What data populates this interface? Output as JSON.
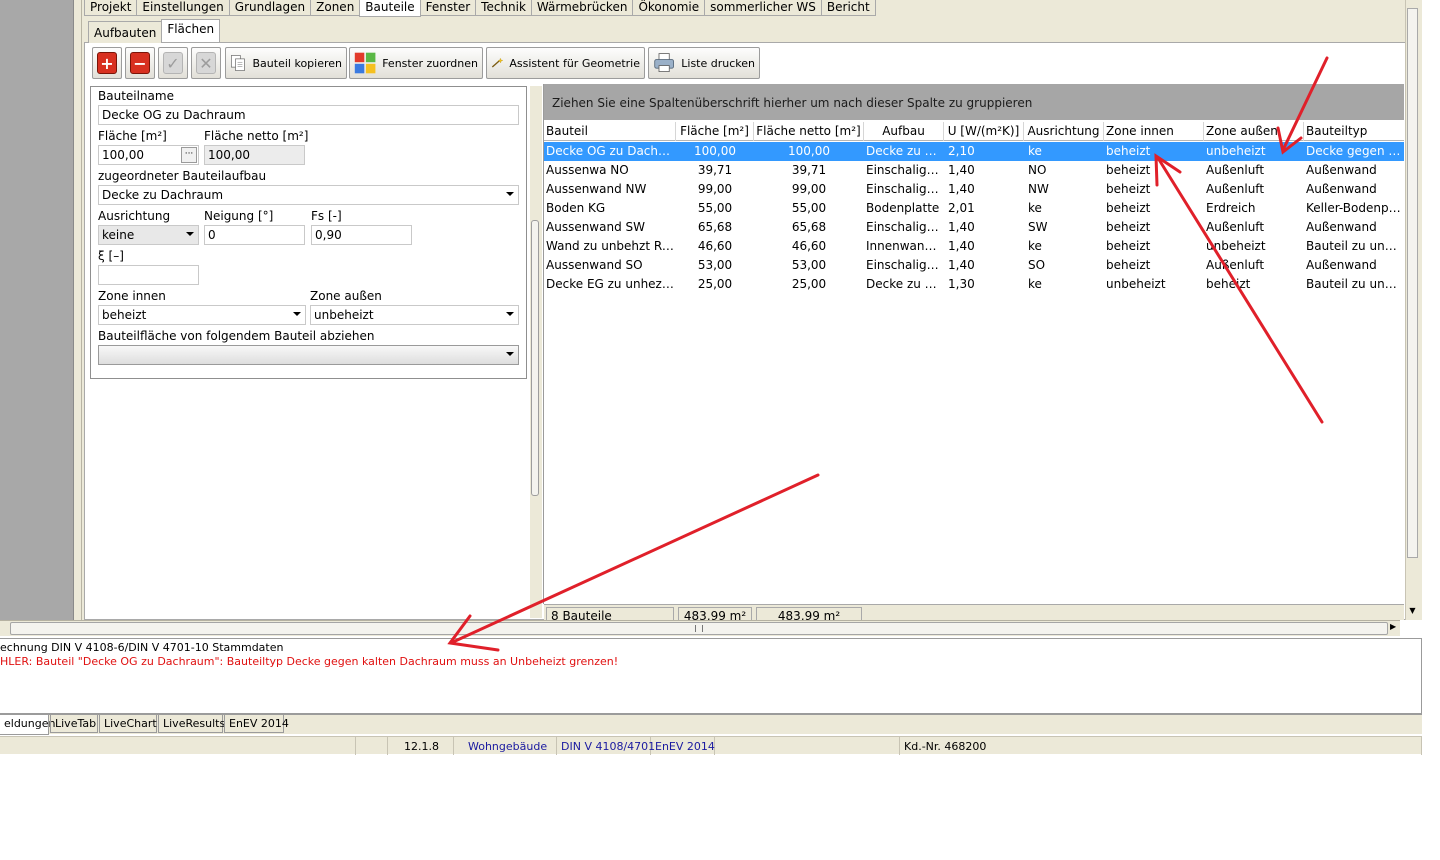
{
  "top_tabs": [
    "Projekt",
    "Einstellungen",
    "Grundlagen",
    "Zonen",
    "Bauteile",
    "Fenster",
    "Technik",
    "Wärmebrücken",
    "Ökonomie",
    "sommerlicher WS",
    "Bericht"
  ],
  "sub_tabs": [
    "Aufbauten",
    "Flächen"
  ],
  "toolbar": {
    "copy_label": "Bauteil kopieren",
    "window_label": "Fenster zuordnen",
    "geometry_label": "Assistent für Geometrie",
    "print_label": "Liste drucken"
  },
  "form": {
    "name_label": "Bauteilname",
    "name_value": "Decke OG zu Dachraum",
    "area_label": "Fläche [m²]",
    "area_value": "100,00",
    "net_area_label": "Fläche netto [m²]",
    "net_area_value": "100,00",
    "construction_label": "zugeordneter Bauteilaufbau",
    "construction_value": "Decke zu Dachraum",
    "orientation_label": "Ausrichtung",
    "orientation_value": "keine",
    "tilt_label": "Neigung [°]",
    "tilt_value": "0",
    "fs_label": "Fs [-]",
    "fs_value": "0,90",
    "xi_label": "ξ [–]",
    "xi_value": "",
    "zone_in_label": "Zone innen",
    "zone_in_value": "beheizt",
    "zone_out_label": "Zone außen",
    "zone_out_value": "unbeheizt",
    "subtract_label": "Bauteilfläche von folgendem Bauteil abziehen",
    "subtract_value": ""
  },
  "grid": {
    "group_hint": "Ziehen Sie eine Spaltenüberschrift hierher um nach dieser Spalte zu gruppieren",
    "columns": [
      "Bauteil",
      "Fläche [m²]",
      "Fläche netto [m²]",
      "Aufbau",
      "U [W/(m²K)]",
      "Ausrichtung",
      "Zone innen",
      "Zone außen",
      "Bauteiltyp"
    ],
    "rows": [
      [
        "Decke OG zu Dachra...",
        "100,00",
        "100,00",
        "Decke zu D...",
        "2,10",
        "ke",
        "beheizt",
        "unbeheizt",
        "Decke gegen kalten"
      ],
      [
        "Aussenwa NO",
        "39,71",
        "39,71",
        "Einschalige ...",
        "1,40",
        "NO",
        "beheizt",
        "Außenluft",
        "Außenwand"
      ],
      [
        "Aussenwand NW",
        "99,00",
        "99,00",
        "Einschalige ...",
        "1,40",
        "NW",
        "beheizt",
        "Außenluft",
        "Außenwand"
      ],
      [
        "Boden KG",
        "55,00",
        "55,00",
        "Bodenplatte",
        "2,01",
        "ke",
        "beheizt",
        "Erdreich",
        "Keller-Bodenplatte"
      ],
      [
        "Aussenwand SW",
        "65,68",
        "65,68",
        "Einschalige ...",
        "1,40",
        "SW",
        "beheizt",
        "Außenluft",
        "Außenwand"
      ],
      [
        "Wand zu unbehzt Ra...",
        "46,60",
        "46,60",
        "Innenwand...",
        "1,40",
        "ke",
        "beheizt",
        "unbeheizt",
        "Bauteil zu unbeheizt"
      ],
      [
        "Aussenwand SO",
        "53,00",
        "53,00",
        "Einschalige ...",
        "1,40",
        "SO",
        "beheizt",
        "Außenluft",
        "Außenwand"
      ],
      [
        "Decke EG zu unhez. ...",
        "25,00",
        "25,00",
        "Decke zu u...",
        "1,30",
        "ke",
        "unbeheizt",
        "beheizt",
        "Bauteil zu unbeheizt"
      ]
    ],
    "footer": {
      "count": "8 Bauteile",
      "area_sum": "483,99 m²",
      "net_area_sum": "483,99 m²"
    }
  },
  "messages": {
    "line1": "echnung DIN V 4108-6/DIN V 4701-10 Stammdaten",
    "line2": "HLER: Bauteil \"Decke OG zu Dachraum\": Bauteiltyp Decke gegen kalten Dachraum muss an Unbeheizt grenzen!",
    "error_color": "#e01010"
  },
  "bottom_tabs": [
    "eldungen",
    "LiveTab",
    "LiveChart",
    "LiveResults",
    "EnEV 2014"
  ],
  "status": {
    "version": "12.1.8",
    "building": "Wohngebäude",
    "norm": "DIN V 4108/4701",
    "enev": "EnEV 2014",
    "customer": "Kd.-Nr. 468200"
  },
  "colors": {
    "selection": "#3399ff",
    "annotation_arrow": "#e0202a",
    "status_blue": "#1a1aa0"
  }
}
